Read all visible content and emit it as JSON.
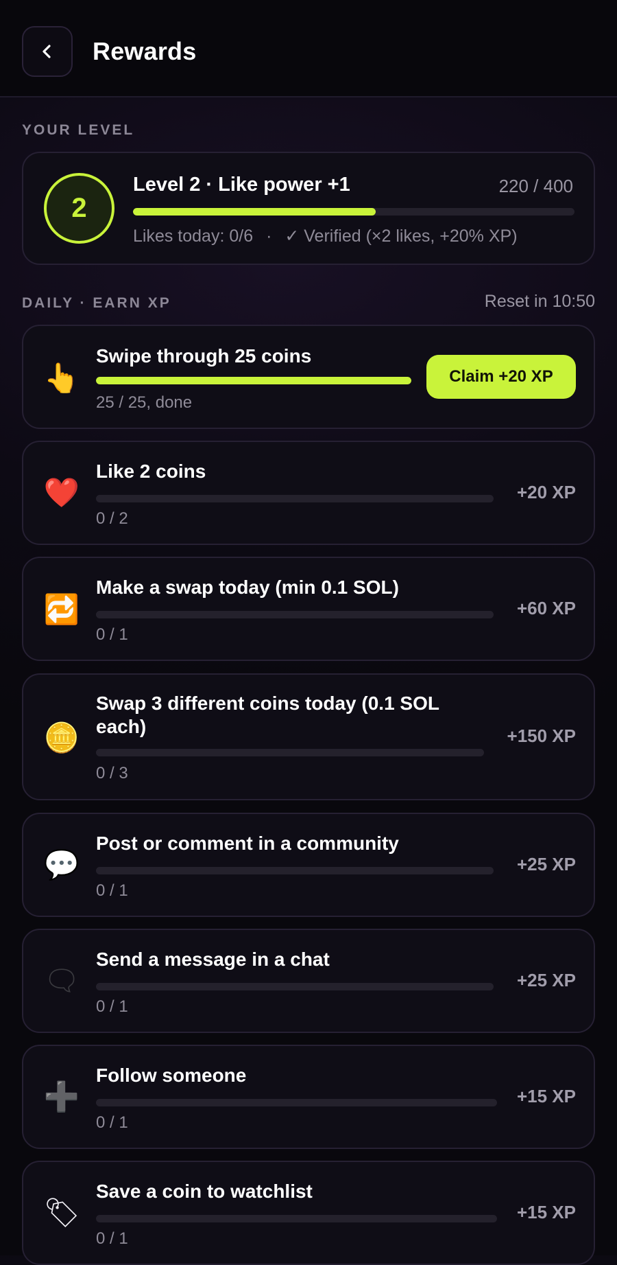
{
  "header": {
    "title": "Rewards",
    "back_icon": "chevron-left-icon"
  },
  "level_section": {
    "label": "YOUR LEVEL",
    "level_number": "2",
    "title": "Level 2 · Like power +1",
    "xp_text": "220 / 400",
    "progress_fraction": 0.55,
    "likes_today": "Likes today: 0/6",
    "separator": "·",
    "verified_text": "✓ Verified (×2 likes, +20% XP)"
  },
  "daily_section": {
    "label": "DAILY · EARN XP",
    "reset_text": "Reset in 10:50"
  },
  "tasks": [
    {
      "icon": "pointing-hand-icon",
      "glyph": "👆",
      "title": "Swipe through 25 coins",
      "progress_text": "25 / 25, done",
      "progress_fraction": 1.0,
      "action_label": "Claim +20 XP"
    },
    {
      "icon": "heart-icon",
      "glyph": "❤️",
      "title": "Like 2 coins",
      "progress_text": "0 / 2",
      "progress_fraction": 0,
      "reward": "+20 XP"
    },
    {
      "icon": "repeat-icon",
      "glyph": "🔁",
      "title": "Make a swap today (min 0.1 SOL)",
      "progress_text": "0 / 1",
      "progress_fraction": 0,
      "reward": "+60 XP"
    },
    {
      "icon": "coin-icon",
      "glyph": "🪙",
      "title": "Swap 3 different coins today (0.1 SOL each)",
      "progress_text": "0 / 3",
      "progress_fraction": 0,
      "reward": "+150 XP"
    },
    {
      "icon": "speech-bubble-icon",
      "glyph": "💬",
      "title": "Post or comment in a community",
      "progress_text": "0 / 1",
      "progress_fraction": 0,
      "reward": "+25 XP"
    },
    {
      "icon": "chat-bubble-icon",
      "glyph": "🗨",
      "title": "Send a message in a chat",
      "progress_text": "0 / 1",
      "progress_fraction": 0,
      "reward": "+25 XP"
    },
    {
      "icon": "plus-icon",
      "glyph": "➕",
      "title": "Follow someone",
      "progress_text": "0 / 1",
      "progress_fraction": 0,
      "reward": "+15 XP"
    },
    {
      "icon": "bookmark-tag-icon",
      "glyph": "🏷",
      "title": "Save a coin to watchlist",
      "progress_text": "0 / 1",
      "progress_fraction": 0,
      "reward": "+15 XP"
    }
  ],
  "colors": {
    "accent": "#c9f33a",
    "background": "#0d0a14",
    "card": "#0f0d16",
    "border": "#262033",
    "muted_text": "#8f8b98"
  }
}
